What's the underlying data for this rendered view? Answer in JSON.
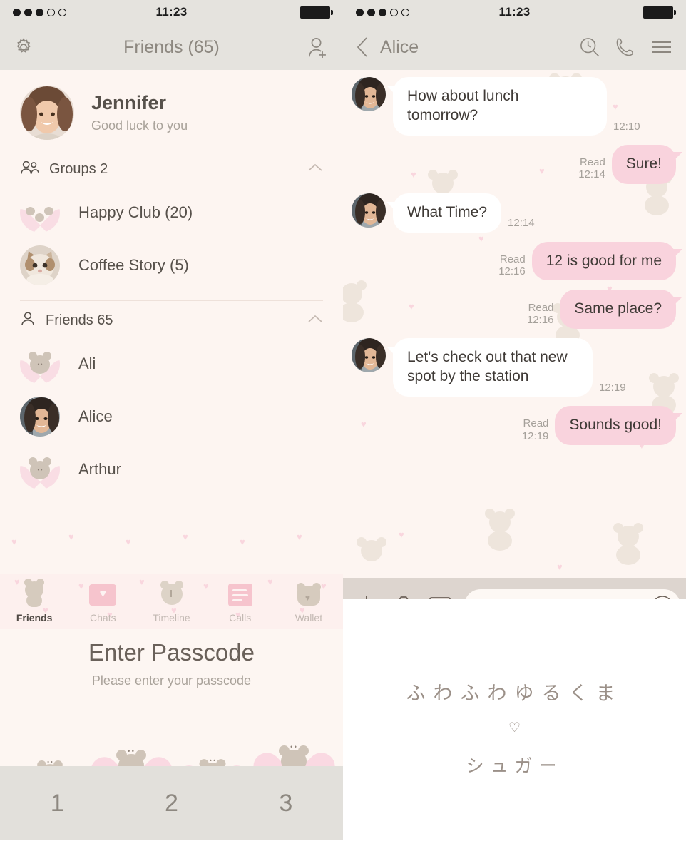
{
  "status_bar": {
    "time": "11:23",
    "signal_filled": 3,
    "signal_total": 5
  },
  "left_panel": {
    "nav": {
      "settings_icon": "gear-icon",
      "title": "Friends (65)",
      "add_friend_icon": "add-user-icon"
    },
    "profile": {
      "name": "Jennifer",
      "status_message": "Good luck to you"
    },
    "groups_section": {
      "icon": "group-icon",
      "label": "Groups 2",
      "collapse_icon": "chevron-up-icon",
      "items": [
        {
          "name": "Happy Club (20)",
          "avatar": "heart-bears-avatar"
        },
        {
          "name": "Coffee Story (5)",
          "avatar": "cat-photo-avatar"
        }
      ]
    },
    "friends_section": {
      "icon": "person-icon",
      "label": "Friends 65",
      "collapse_icon": "chevron-up-icon",
      "items": [
        {
          "name": "Ali",
          "avatar": "heart-bear-avatar"
        },
        {
          "name": "Alice",
          "avatar": "alice-photo-avatar"
        },
        {
          "name": "Arthur",
          "avatar": "heart-bear-avatar"
        }
      ]
    },
    "tab_bar": {
      "tabs": [
        {
          "label": "Friends",
          "icon": "bear-icon",
          "active": true
        },
        {
          "label": "Chats",
          "icon": "envelope-heart-icon",
          "active": false
        },
        {
          "label": "Timeline",
          "icon": "bear-clock-icon",
          "active": false
        },
        {
          "label": "Calls",
          "icon": "list-lines-icon",
          "active": false
        },
        {
          "label": "Wallet",
          "icon": "bear-wallet-icon",
          "active": false
        }
      ]
    }
  },
  "passcode_panel": {
    "title": "Enter Passcode",
    "subtitle": "Please enter your passcode",
    "dots_count": 4,
    "dot_icon": "heart-bear-dot",
    "keypad_row": [
      "1",
      "2",
      "3"
    ]
  },
  "right_panel": {
    "nav": {
      "back_icon": "chevron-left-icon",
      "title": "Alice",
      "actions": [
        {
          "icon": "search-clock-icon",
          "name": "history-search"
        },
        {
          "icon": "phone-icon",
          "name": "call"
        },
        {
          "icon": "hamburger-icon",
          "name": "menu"
        }
      ]
    },
    "messages": [
      {
        "side": "in",
        "text": "How about lunch tomorrow?",
        "time": "12:10",
        "read": "",
        "avatar": true
      },
      {
        "side": "out",
        "text": "Sure!",
        "time": "12:14",
        "read": "Read",
        "avatar": false
      },
      {
        "side": "in",
        "text": "What Time?",
        "time": "12:14",
        "read": "",
        "avatar": true
      },
      {
        "side": "out",
        "text": "12 is good for me",
        "time": "12:16",
        "read": "Read",
        "avatar": false
      },
      {
        "side": "out",
        "text": "Same place?",
        "time": "12:16",
        "read": "Read",
        "avatar": false
      },
      {
        "side": "in",
        "text": "Let's check out that new spot by the station",
        "time": "12:19",
        "read": "",
        "avatar": true
      },
      {
        "side": "out",
        "text": "Sounds good!",
        "time": "12:19",
        "read": "Read",
        "avatar": false
      }
    ],
    "input_bar": {
      "plus_icon": "plus-icon",
      "camera_icon": "camera-icon",
      "photo_icon": "image-icon",
      "text_value": "",
      "text_placeholder": "",
      "emoji_icon": "smiley-icon",
      "mic_icon": "microphone-icon"
    }
  },
  "branding": {
    "line1": "ふわふわゆるくま",
    "heart": "♡",
    "line2": "シュガー"
  },
  "colors": {
    "header_bar": "#e5e3de",
    "panel_bg": "#fdf5f1",
    "bubble_out": "#f9d3dd",
    "bubble_in": "#ffffff",
    "accent_pink": "#f6c4cd",
    "text_primary": "#57514b",
    "text_muted": "#a9a29a",
    "input_bar": "#ddd5cf",
    "keypad": "#e2e0db"
  }
}
